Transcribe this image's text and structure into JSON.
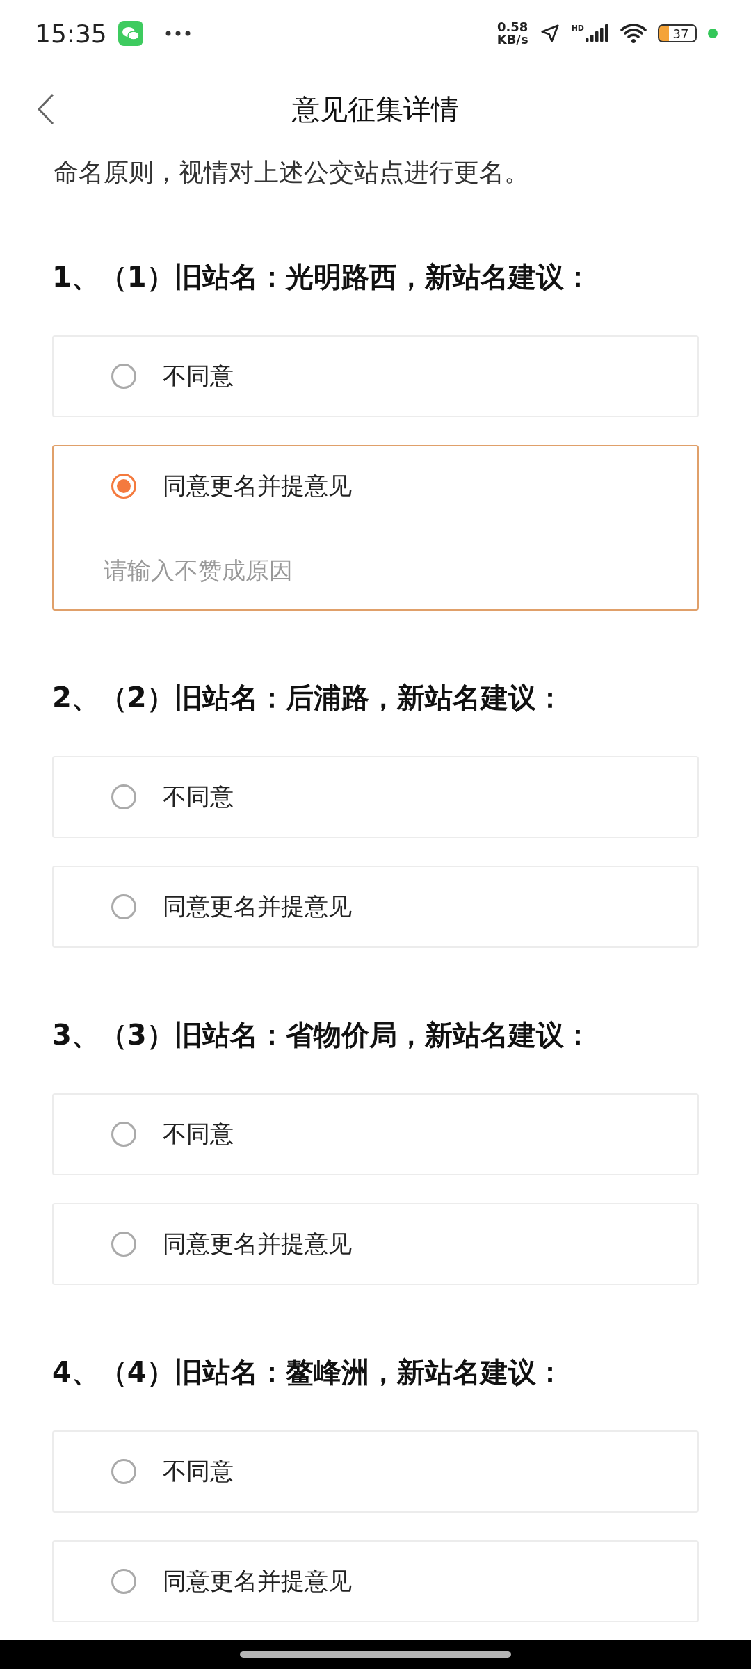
{
  "status_bar": {
    "time": "15:35",
    "speed_value": "0.58",
    "speed_unit": "KB/s",
    "signal_label": "HD",
    "battery": "37"
  },
  "header": {
    "title": "意见征集详情"
  },
  "intro": "命名原则，视情对上述公交站点进行更名。",
  "questions": [
    {
      "title": "1、（1）旧站名：光明路西，新站名建议：",
      "options": [
        {
          "label": "不同意",
          "selected": false
        },
        {
          "label": "同意更名并提意见",
          "selected": true,
          "placeholder": "请输入不赞成原因"
        }
      ]
    },
    {
      "title": "2、（2）旧站名：后浦路，新站名建议：",
      "options": [
        {
          "label": "不同意",
          "selected": false
        },
        {
          "label": "同意更名并提意见",
          "selected": false
        }
      ]
    },
    {
      "title": "3、（3）旧站名：省物价局，新站名建议：",
      "options": [
        {
          "label": "不同意",
          "selected": false
        },
        {
          "label": "同意更名并提意见",
          "selected": false
        }
      ]
    },
    {
      "title": "4、（4）旧站名：鳌峰洲，新站名建议：",
      "options": [
        {
          "label": "不同意",
          "selected": false
        },
        {
          "label": "同意更名并提意见",
          "selected": false
        }
      ]
    }
  ]
}
